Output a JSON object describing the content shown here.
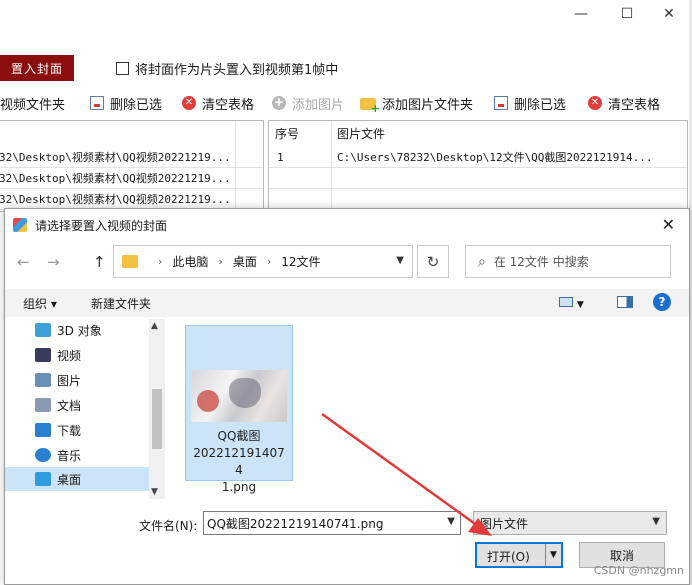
{
  "window": {
    "controls": {
      "minimize": "—",
      "maximize": "☐",
      "close": "✕"
    }
  },
  "main": {
    "cover_button": "置入封面",
    "cover_checkbox_label": "将封面作为片头置入到视频第1帧中",
    "toolbar": {
      "add_folder": "视频文件夹",
      "delete_selected_left": "删除已选",
      "clear_table_left": "清空表格",
      "add_image": "添加图片",
      "add_image_folder": "添加图片文件夹",
      "delete_selected_right": "删除已选",
      "clear_table_right": "清空表格"
    },
    "left_rows": [
      "32\\Desktop\\视频素材\\QQ视频20221219...",
      "32\\Desktop\\视频素材\\QQ视频20221219...",
      "32\\Desktop\\视频素材\\QQ视频20221219..."
    ],
    "right_table": {
      "headers": [
        "序号",
        "图片文件"
      ],
      "rows": [
        {
          "index": "1",
          "file": "C:\\Users\\78232\\Desktop\\12文件\\QQ截图2022121914..."
        }
      ]
    }
  },
  "dialog": {
    "title": "请选择要置入视频的封面",
    "close": "✕",
    "nav": {
      "back": "←",
      "forward": "→",
      "up": "↑"
    },
    "breadcrumb": [
      "此电脑",
      "桌面",
      "12文件"
    ],
    "breadcrumb_sep": "›",
    "refresh": "↻",
    "search_placeholder": "在 12文件 中搜索",
    "toolbar": {
      "organize": "组织 ▾",
      "new_folder": "新建文件夹",
      "help": "?"
    },
    "tree": [
      {
        "label": "3D 对象",
        "icon": "cube-icon",
        "color": "#3fa0d9"
      },
      {
        "label": "视频",
        "icon": "video-icon",
        "color": "#3a3a5a"
      },
      {
        "label": "图片",
        "icon": "picture-icon",
        "color": "#6a8fb8"
      },
      {
        "label": "文档",
        "icon": "document-icon",
        "color": "#8a9ab0"
      },
      {
        "label": "下载",
        "icon": "download-icon",
        "color": "#2a7fd0"
      },
      {
        "label": "音乐",
        "icon": "music-icon",
        "color": "#2a7fd0"
      },
      {
        "label": "桌面",
        "icon": "desktop-icon",
        "color": "#2f9be0"
      }
    ],
    "selected_tree": "桌面",
    "file": {
      "name_lines": [
        "QQ截图",
        "2022121914074",
        "1.png"
      ]
    },
    "filename_label": "文件名(N):",
    "filename_value": "QQ截图20221219140741.png",
    "filetype_value": "图片文件",
    "open_button": "打开(O)",
    "cancel_button": "取消"
  },
  "watermark": "CSDN @nhzgmn",
  "colors": {
    "cover_button": "#8b0d0d",
    "selection": "#cce4f7",
    "accent": "#0078d7",
    "arrow": "#e03a3a"
  }
}
